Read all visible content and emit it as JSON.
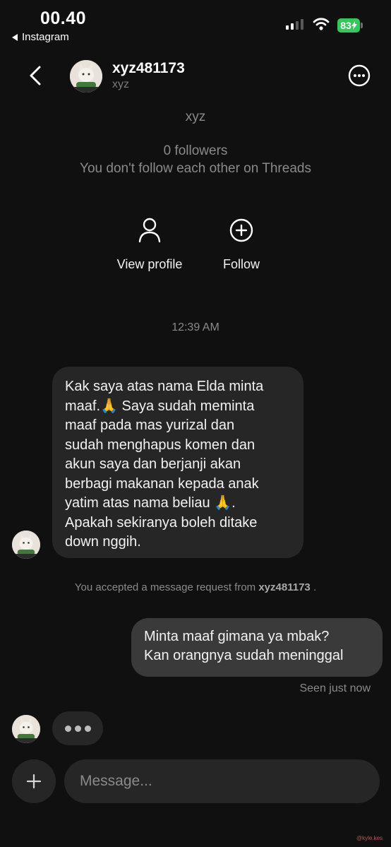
{
  "status_bar": {
    "time": "00.40",
    "back_app": "Instagram",
    "battery": "83"
  },
  "header": {
    "username": "xyz481173",
    "display_name": "xyz"
  },
  "profile_info": {
    "name": "xyz",
    "followers": "0 followers",
    "mutual_status": "You don't follow each other on Threads",
    "actions": {
      "view_profile": "View profile",
      "follow": "Follow"
    }
  },
  "conversation": {
    "timestamp": "12:39 AM",
    "incoming_message": {
      "lines": [
        "Kak saya atas nama Elda minta",
        "maaf.🙏 Saya sudah meminta",
        "maaf pada mas yurizal dan",
        "sudah menghapus komen dan",
        "akun saya dan berjanji akan",
        "berbagi makanan kepada anak",
        "yatim atas nama beliau 🙏.",
        "Apakah sekiranya boleh ditake",
        "down nggih."
      ]
    },
    "request_notice": {
      "prefix": "You accepted a message request from",
      "username": "xyz481173",
      "suffix": "."
    },
    "outgoing_message": {
      "lines": [
        "Minta maaf gimana ya mbak?",
        "Kan orangnya sudah meninggal"
      ]
    },
    "seen_status": "Seen just now"
  },
  "composer": {
    "placeholder": "Message..."
  },
  "watermark": "@kyle.kes"
}
